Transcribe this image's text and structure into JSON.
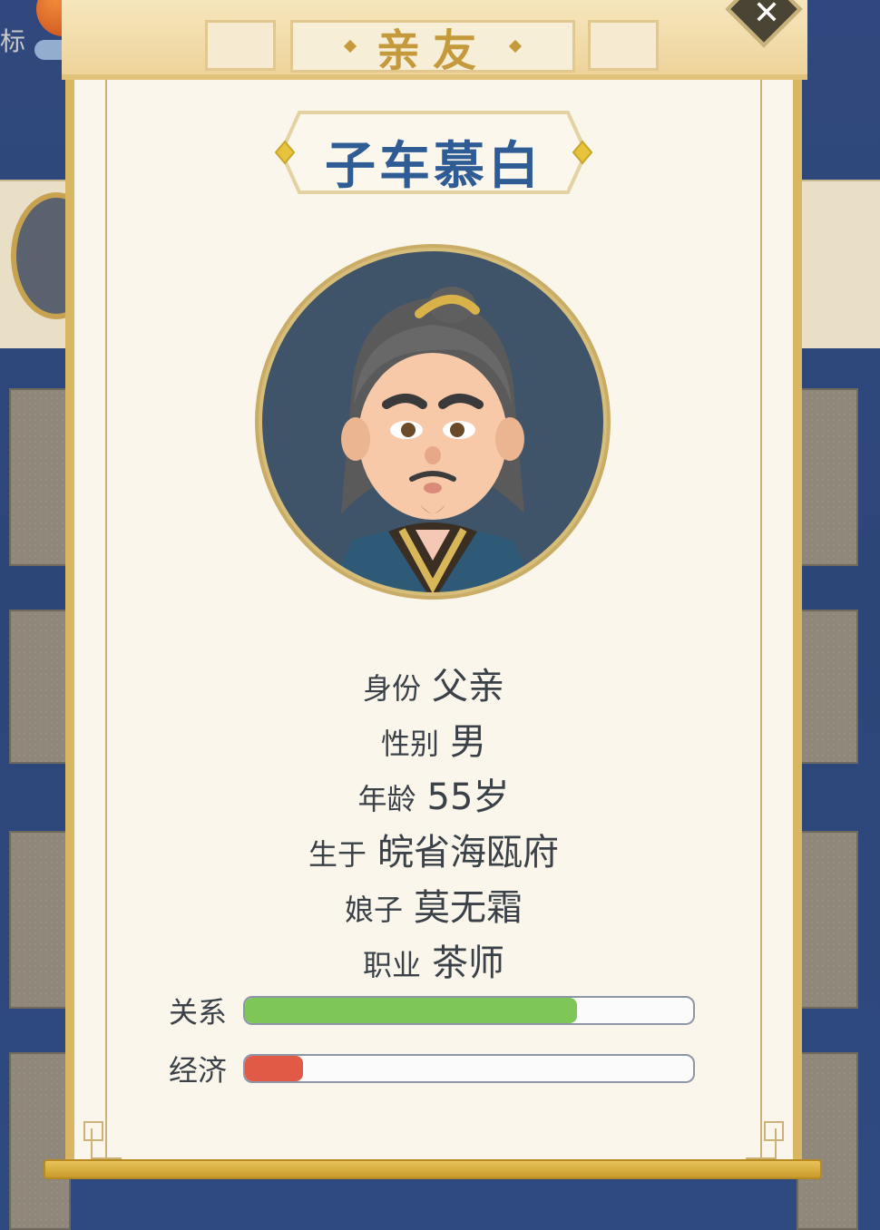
{
  "header": {
    "title": "亲友"
  },
  "background": {
    "partial_text": "标"
  },
  "person": {
    "name": "子车慕白",
    "info": [
      {
        "label": "身份",
        "value": "父亲"
      },
      {
        "label": "性别",
        "value": "男"
      },
      {
        "label": "年龄",
        "value": "55岁"
      },
      {
        "label": "生于",
        "value": "皖省海瓯府"
      },
      {
        "label": "娘子",
        "value": "莫无霜"
      },
      {
        "label": "职业",
        "value": "茶师"
      }
    ]
  },
  "stats": {
    "relation": {
      "label": "关系",
      "level": 0.74,
      "color": "#7ec657"
    },
    "economy": {
      "label": "经济",
      "level": 0.13,
      "color": "#e05a45"
    }
  },
  "colors": {
    "name": "#2f5c95",
    "title": "#c59a3c",
    "panel": "#faf6ec",
    "frame": "#d9b661"
  },
  "icons": {
    "close": "close-icon",
    "portrait": "old-man-portrait"
  }
}
